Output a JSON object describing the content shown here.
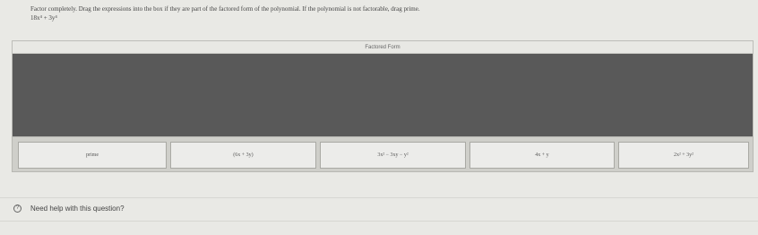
{
  "question": {
    "instructions": "Factor completely. Drag the expressions into the box if they are part of the factored form of the polynomial. If the polynomial is not factorable, drag prime.",
    "polynomial": "18x⁴ + 3y⁴"
  },
  "drop_zone": {
    "header": "Factored Form"
  },
  "tiles": [
    {
      "label": "prime"
    },
    {
      "label": "(6x + 3y)"
    },
    {
      "label": "3x² − 3xy − y²"
    },
    {
      "label": "4x + y"
    },
    {
      "label": "2x² + 3y²"
    }
  ],
  "help": {
    "icon": "help-circle-icon",
    "label": "Need help with this question?"
  },
  "colors": {
    "drop_area": "#595959",
    "page_background": "#e9e9e5",
    "tile_background": "#ececea"
  }
}
